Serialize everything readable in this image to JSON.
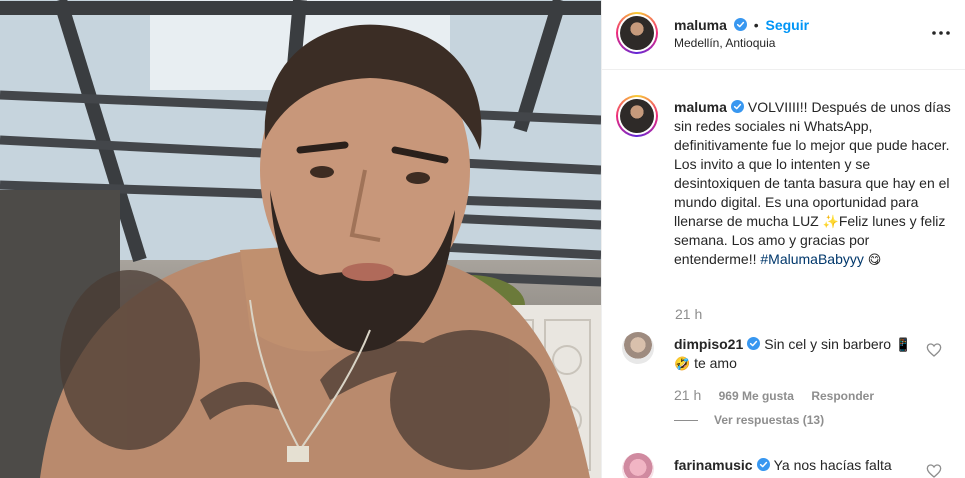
{
  "post": {
    "username": "maluma",
    "follow_label": "Seguir",
    "separator": "•",
    "location": "Medellín, Antioquia",
    "caption_text": "VOLVIIII!! Después de unos días sin redes sociales ni WhatsApp, definitivamente fue lo mejor que pude hacer. Los invito a que lo intenten y se desintoxiquen de tanta basura que hay en el mundo digital. Es una oportunidad para llenarse de mucha LUZ",
    "caption_emoji_1": "✨",
    "caption_text_2": "Feliz lunes y feliz semana. Los amo y gracias por entenderme!!",
    "hashtag": "#MalumaBabyyy",
    "caption_emoji_2": "😋",
    "caption_time": "21 h"
  },
  "comments": [
    {
      "username": "dimpiso21",
      "text": "Sin cel y sin barbero",
      "emoji_1": "📱",
      "emoji_2": "🤣",
      "text_2": "te amo",
      "age": "21 h",
      "likes": "969 Me gusta",
      "reply_label": "Responder",
      "view_replies": "Ver respuestas (13)"
    },
    {
      "username": "farinamusic",
      "text": "Ya nos hacías falta"
    }
  ],
  "icons": {
    "verified": "verified-badge-icon",
    "more": "more-options-icon",
    "heart": "heart-icon"
  },
  "colors": {
    "link_blue": "#0095f6",
    "verified_blue": "#3897f0",
    "hashtag": "#00376b",
    "muted": "#8e8e8e"
  }
}
